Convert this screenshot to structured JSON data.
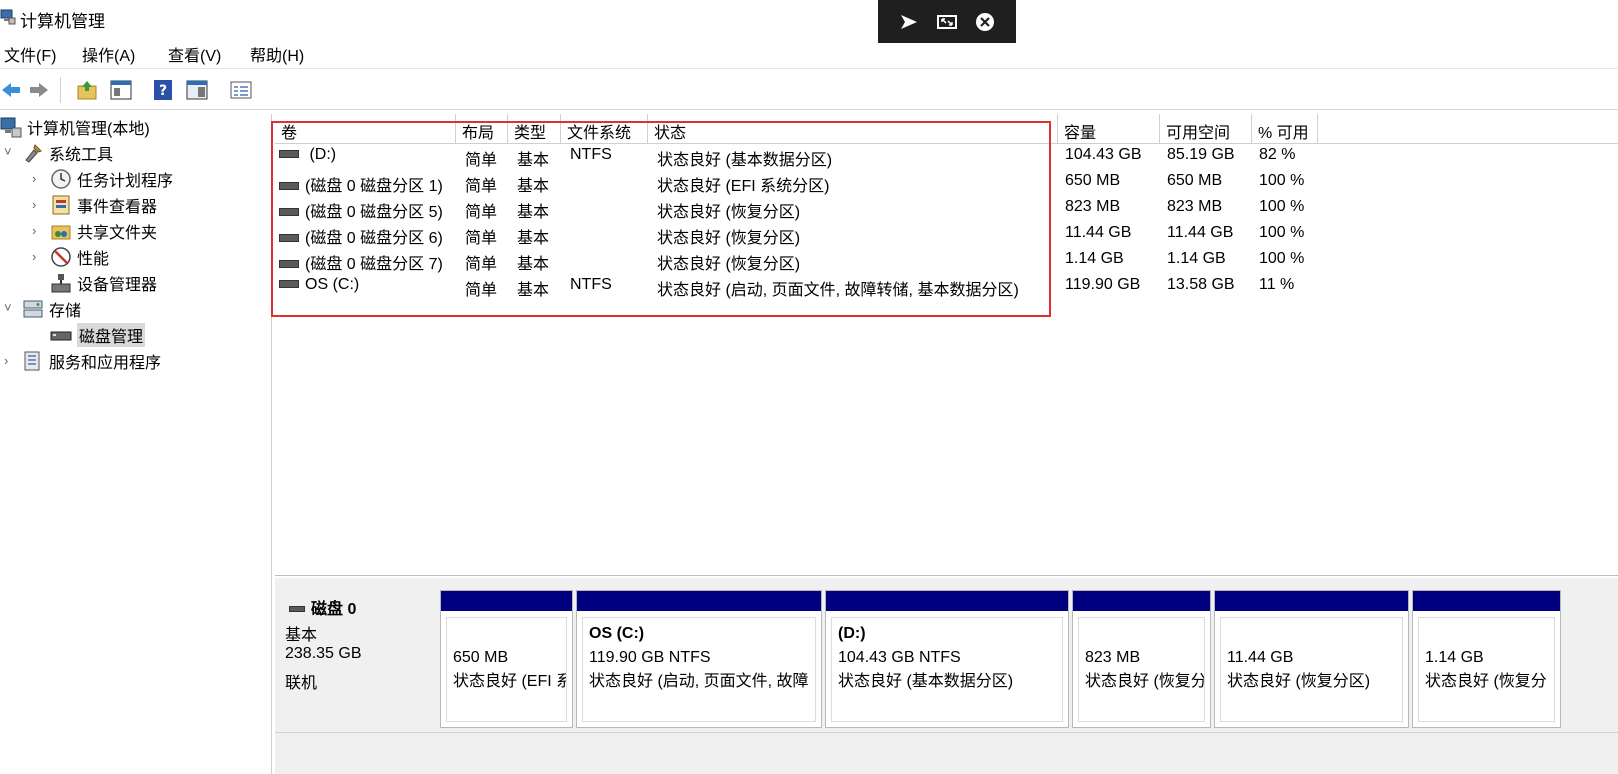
{
  "window": {
    "title": "计算机管理"
  },
  "menu": [
    "文件(F)",
    "操作(A)",
    "查看(V)",
    "帮助(H)"
  ],
  "toolbar_icons": [
    "back-arrow-icon",
    "forward-arrow-icon",
    "up-folder-icon",
    "show-hide-tree-icon",
    "help-icon",
    "panel-icon",
    "properties-icon"
  ],
  "tree": {
    "root": "计算机管理(本地)",
    "items": [
      {
        "label": "系统工具",
        "level": 1,
        "expand": "˅",
        "icon": "tools-icon"
      },
      {
        "label": "任务计划程序",
        "level": 2,
        "expand": "›",
        "icon": "clock-icon"
      },
      {
        "label": "事件查看器",
        "level": 2,
        "expand": "›",
        "icon": "event-viewer-icon"
      },
      {
        "label": "共享文件夹",
        "level": 2,
        "expand": "›",
        "icon": "shared-folder-icon"
      },
      {
        "label": "性能",
        "level": 2,
        "expand": "›",
        "icon": "performance-icon"
      },
      {
        "label": "设备管理器",
        "level": 2,
        "expand": "",
        "icon": "device-manager-icon"
      },
      {
        "label": "存储",
        "level": 1,
        "expand": "˅",
        "icon": "storage-icon"
      },
      {
        "label": "磁盘管理",
        "level": 2,
        "expand": "",
        "icon": "disk-management-icon",
        "selected": true
      },
      {
        "label": "服务和应用程序",
        "level": 1,
        "expand": "›",
        "icon": "services-icon"
      }
    ]
  },
  "volume_table": {
    "columns": [
      "卷",
      "布局",
      "类型",
      "文件系统",
      "状态",
      "容量",
      "可用空间",
      "% 可用"
    ],
    "rows": [
      [
        " (D:)",
        "简单",
        "基本",
        "NTFS",
        "状态良好 (基本数据分区)",
        "104.43 GB",
        "85.19 GB",
        "82 %"
      ],
      [
        "(磁盘 0 磁盘分区 1)",
        "简单",
        "基本",
        "",
        "状态良好 (EFI 系统分区)",
        "650 MB",
        "650 MB",
        "100 %"
      ],
      [
        "(磁盘 0 磁盘分区 5)",
        "简单",
        "基本",
        "",
        "状态良好 (恢复分区)",
        "823 MB",
        "823 MB",
        "100 %"
      ],
      [
        "(磁盘 0 磁盘分区 6)",
        "简单",
        "基本",
        "",
        "状态良好 (恢复分区)",
        "11.44 GB",
        "11.44 GB",
        "100 %"
      ],
      [
        "(磁盘 0 磁盘分区 7)",
        "简单",
        "基本",
        "",
        "状态良好 (恢复分区)",
        "1.14 GB",
        "1.14 GB",
        "100 %"
      ],
      [
        "OS (C:)",
        "简单",
        "基本",
        "NTFS",
        "状态良好 (启动, 页面文件, 故障转储, 基本数据分区)",
        "119.90 GB",
        "13.58 GB",
        "11 %"
      ]
    ]
  },
  "disk": {
    "name": "磁盘 0",
    "type": "基本",
    "size": "238.35 GB",
    "status": "联机",
    "partition_bar_color": "#000080",
    "partitions": [
      {
        "name": "",
        "size": "650 MB",
        "status": "状态良好 (EFI 系"
      },
      {
        "name": "OS  (C:)",
        "size": "119.90 GB NTFS",
        "status": "状态良好 (启动, 页面文件, 故障"
      },
      {
        "name": " (D:)",
        "size": "104.43 GB NTFS",
        "status": "状态良好 (基本数据分区)"
      },
      {
        "name": "",
        "size": "823 MB",
        "status": "状态良好 (恢复分"
      },
      {
        "name": "",
        "size": "11.44 GB",
        "status": "状态良好 (恢复分区)"
      },
      {
        "name": "",
        "size": "1.14 GB",
        "status": "状态良好 (恢复分"
      }
    ]
  },
  "colors": {
    "highlight": "#e03131",
    "selection": "#d9d9d9",
    "overlay": "#1f1f1f"
  }
}
